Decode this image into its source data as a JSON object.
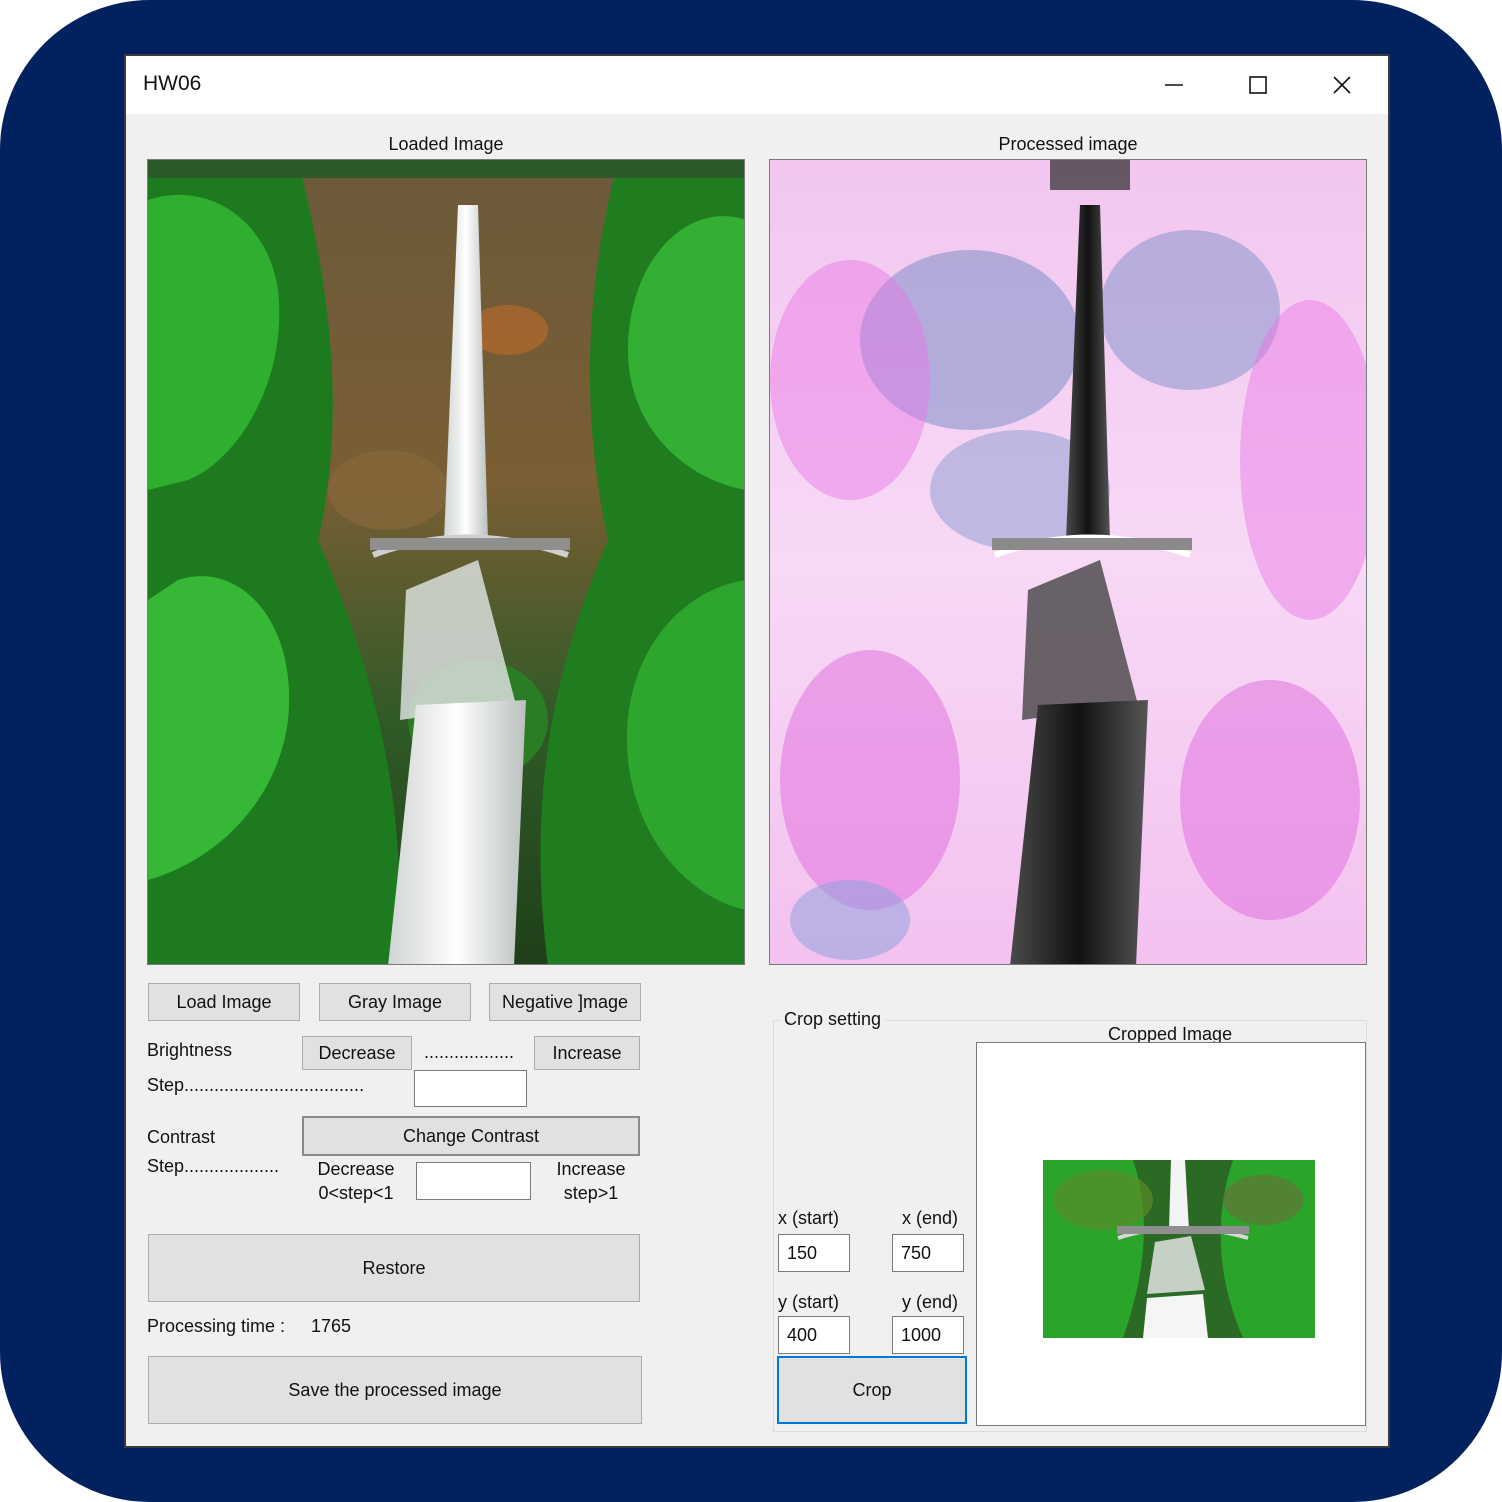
{
  "window": {
    "title": "HW06",
    "controls": {
      "minimize": "—",
      "maximize": "☐",
      "close": "✕"
    }
  },
  "panels": {
    "loaded_label": "Loaded Image",
    "processed_label": "Processed image",
    "cropped_label": "Cropped Image"
  },
  "buttons": {
    "load": "Load Image",
    "gray": "Gray Image",
    "negative": "Negative ]mage",
    "brightness_decrease": "Decrease",
    "brightness_increase": "Increase",
    "change_contrast": "Change Contrast",
    "restore": "Restore",
    "save": "Save the processed image",
    "crop": "Crop"
  },
  "brightness": {
    "label": "Brightness",
    "dots": "..................",
    "step_label": "Step....................................",
    "step_value": ""
  },
  "contrast": {
    "label": "Contrast",
    "step_label": "Step...................",
    "decrease_label": "Decrease",
    "decrease_hint": "0<step<1",
    "increase_label": "Increase",
    "increase_hint": "step>1",
    "step_value": ""
  },
  "processing": {
    "label": "Processing time :",
    "value": "1765"
  },
  "crop": {
    "group_label": "Crop setting",
    "x_start_label": "x (start)",
    "x_end_label": "x (end)",
    "y_start_label": "y (start)",
    "y_end_label": "y (end)",
    "x_start": "150",
    "x_end": "750",
    "y_start": "400",
    "y_end": "1000"
  },
  "colors": {
    "frame_bg": "#02215f",
    "window_bg": "#f0f0f0",
    "button_bg": "#e1e1e1",
    "focus_accent": "#0078d7",
    "forest_green": "#2e8b2e",
    "negative_pink": "#f2a6f0"
  }
}
